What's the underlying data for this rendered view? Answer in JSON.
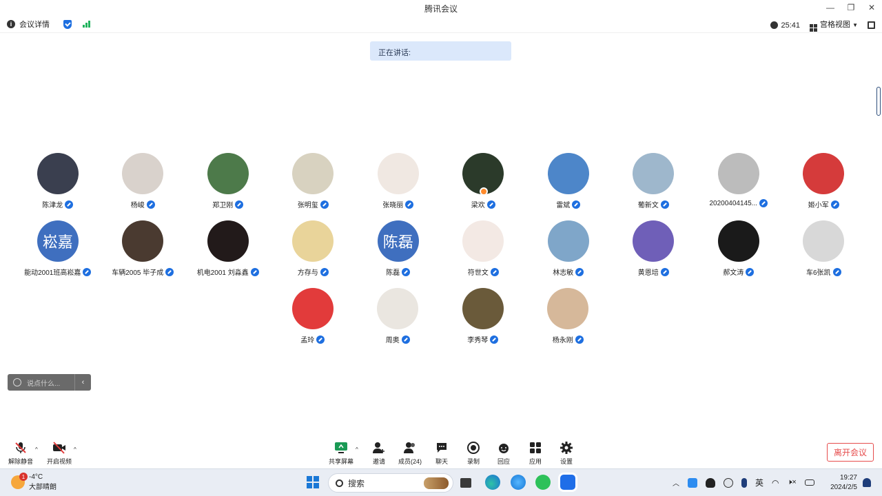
{
  "window": {
    "title": "腾讯会议",
    "controls": [
      "—",
      "❐",
      "✕"
    ]
  },
  "infobar": {
    "meeting_details": "会议详情",
    "timer": "25:41",
    "view_mode": "宫格视图",
    "view_caret": "▼"
  },
  "speaking": {
    "label": "正在讲话:"
  },
  "participants": [
    {
      "name": "陈津龙",
      "avatar_color": "#3a3f4f"
    },
    {
      "name": "杨峻",
      "avatar_color": "#d9d2cc"
    },
    {
      "name": "郑卫刚",
      "avatar_color": "#4d7a4a"
    },
    {
      "name": "张明玺",
      "avatar_color": "#d8d2c0"
    },
    {
      "name": "张晓丽",
      "avatar_color": "#f0e8e2"
    },
    {
      "name": "梁欢",
      "avatar_color": "#2b3a2a"
    },
    {
      "name": "雷斌",
      "avatar_color": "#4d86c9"
    },
    {
      "name": "葡新文",
      "avatar_color": "#9eb7cc"
    },
    {
      "name": "20200404145...",
      "avatar_color": "#bcbcbc"
    },
    {
      "name": "姬小军",
      "avatar_color": "#d53b3b"
    },
    {
      "name": "能动2001班高崧嘉",
      "avatar_color": "#3f6fbf",
      "initials": "崧嘉"
    },
    {
      "name": "车辆2005 毕子成",
      "avatar_color": "#4a3a30"
    },
    {
      "name": "机电2001 刘淼鑫",
      "avatar_color": "#221a1a"
    },
    {
      "name": "方存与",
      "avatar_color": "#e9d49a"
    },
    {
      "name": "陈磊",
      "avatar_color": "#3f6fbf",
      "initials": "陈磊"
    },
    {
      "name": "符世文",
      "avatar_color": "#f3e9e4"
    },
    {
      "name": "林志敏",
      "avatar_color": "#7fa6c9"
    },
    {
      "name": "黄恩培",
      "avatar_color": "#6f5fb8"
    },
    {
      "name": "郝文涛",
      "avatar_color": "#1a1a1a"
    },
    {
      "name": "车6张凯",
      "avatar_color": "#d8d8d8"
    },
    {
      "name": "孟玲",
      "avatar_color": "#e23b3b"
    },
    {
      "name": "周奥",
      "avatar_color": "#eae6e0"
    },
    {
      "name": "李秀琴",
      "avatar_color": "#6a5a3a"
    },
    {
      "name": "杨永刚",
      "avatar_color": "#d6b89a"
    }
  ],
  "chat": {
    "placeholder": "说点什么...",
    "collapse": "‹"
  },
  "toolbar": {
    "unmute": "解除静音",
    "start_video": "开启视频",
    "share_screen": "共享屏幕",
    "invite": "邀请",
    "members": "成员(24)",
    "chat": "聊天",
    "record": "录制",
    "reactions": "回应",
    "apps": "应用",
    "settings": "设置",
    "leave": "离开会议",
    "caret": "^"
  },
  "taskbar": {
    "weather_temp": "-4°C",
    "weather_desc": "大部晴朗",
    "weather_badge": "1",
    "search": "搜索",
    "ime": "英",
    "time": "19:27",
    "date": "2024/2/5"
  },
  "colors": {
    "accent": "#1e6fe0",
    "leave": "#e64b4b",
    "signal": "#22b35e"
  }
}
